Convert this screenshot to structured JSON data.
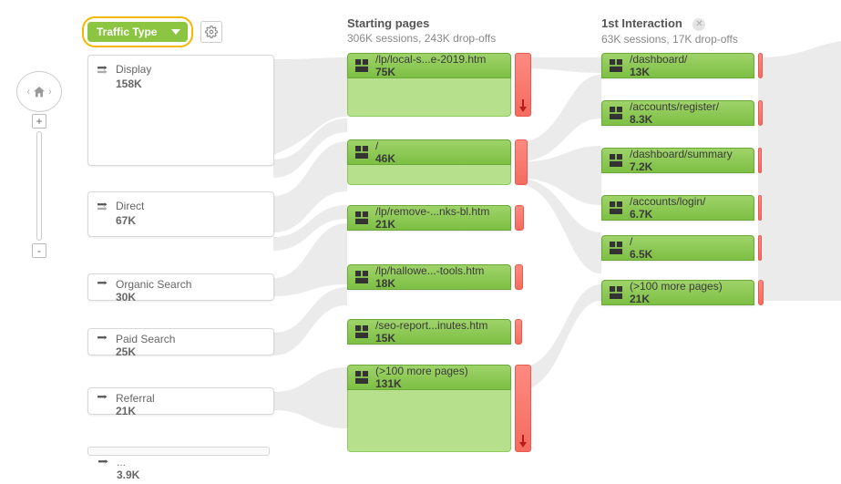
{
  "dropdown": {
    "label": "Traffic Type"
  },
  "columns": {
    "starting": {
      "title": "Starting pages",
      "sub": "306K sessions, 243K drop-offs"
    },
    "first": {
      "title": "1st Interaction",
      "sub": "63K sessions, 17K drop-offs"
    }
  },
  "sources": [
    {
      "label": "Display",
      "count": "158K"
    },
    {
      "label": "Direct",
      "count": "67K"
    },
    {
      "label": "Organic Search",
      "count": "30K"
    },
    {
      "label": "Paid Search",
      "count": "25K"
    },
    {
      "label": "Referral",
      "count": "21K"
    },
    {
      "label": "...",
      "count": "3.9K"
    }
  ],
  "starting_pages": [
    {
      "label": "/lp/local-s...e-2019.htm",
      "count": "75K"
    },
    {
      "label": "/",
      "count": "46K"
    },
    {
      "label": "/lp/remove-...nks-bl.htm",
      "count": "21K"
    },
    {
      "label": "/lp/hallowe...-tools.htm",
      "count": "18K"
    },
    {
      "label": "/seo-report...inutes.htm",
      "count": "15K"
    },
    {
      "label": "(>100 more pages)",
      "count": "131K"
    }
  ],
  "first_interaction": [
    {
      "label": "/dashboard/",
      "count": "13K"
    },
    {
      "label": "/accounts/register/",
      "count": "8.3K"
    },
    {
      "label": "/dashboard/summary",
      "count": "7.2K"
    },
    {
      "label": "/accounts/login/",
      "count": "6.7K"
    },
    {
      "label": "/",
      "count": "6.5K"
    },
    {
      "label": "(>100 more pages)",
      "count": "21K"
    }
  ]
}
